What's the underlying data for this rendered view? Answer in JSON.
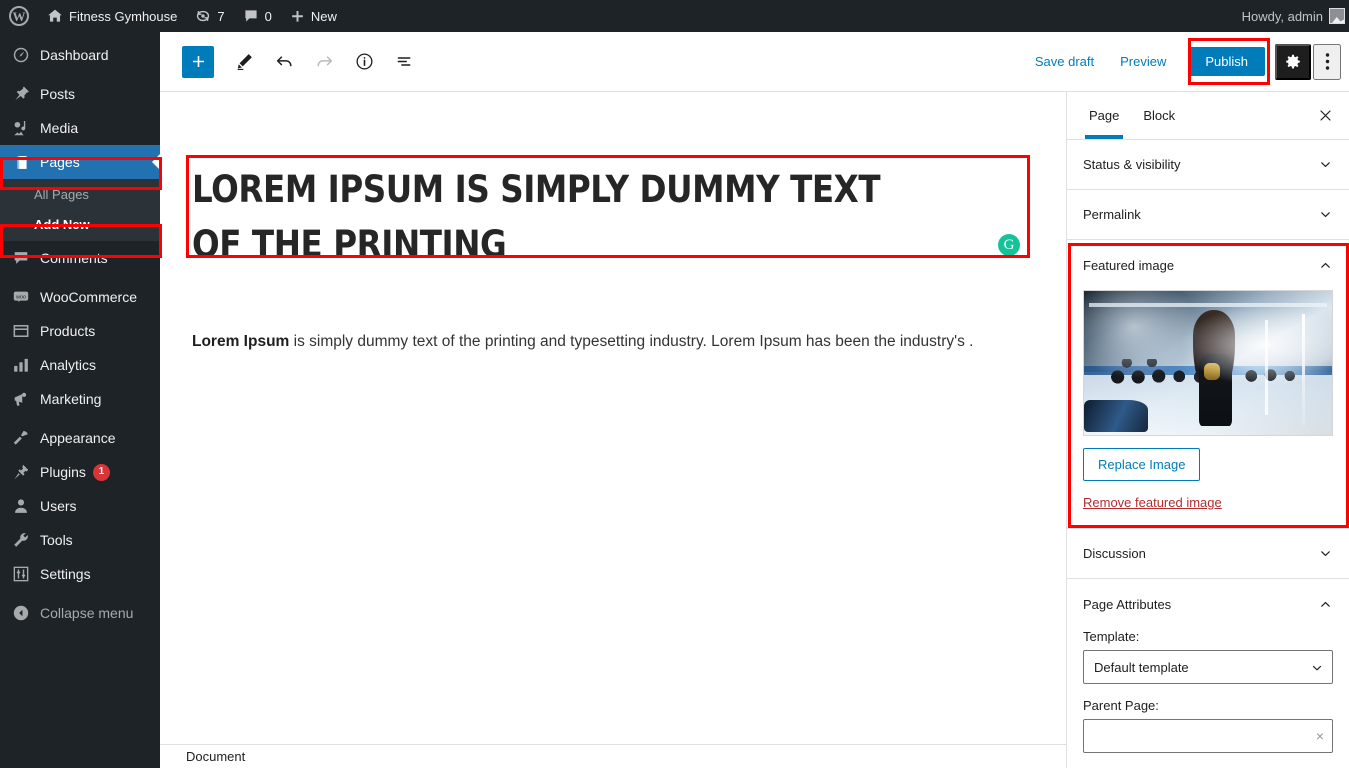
{
  "adminbar": {
    "wp_logo": "wordpress-logo",
    "site_name": "Fitness Gymhouse",
    "updates_count": "7",
    "comments_count": "0",
    "new_label": "New",
    "howdy": "Howdy, admin"
  },
  "sidebar": {
    "items": [
      {
        "label": "Dashboard",
        "icon": "dashboard-icon",
        "current": false
      },
      {
        "label": "Posts",
        "icon": "pin-icon",
        "current": false
      },
      {
        "label": "Media",
        "icon": "media-icon",
        "current": false
      },
      {
        "label": "Pages",
        "icon": "pages-icon",
        "current": true
      },
      {
        "label": "Comments",
        "icon": "comments-icon",
        "current": false
      },
      {
        "label": "WooCommerce",
        "icon": "woocommerce-icon",
        "current": false
      },
      {
        "label": "Products",
        "icon": "products-icon",
        "current": false
      },
      {
        "label": "Analytics",
        "icon": "analytics-icon",
        "current": false
      },
      {
        "label": "Marketing",
        "icon": "marketing-icon",
        "current": false
      },
      {
        "label": "Appearance",
        "icon": "appearance-icon",
        "current": false
      },
      {
        "label": "Plugins",
        "icon": "plugins-icon",
        "current": false,
        "badge": "1"
      },
      {
        "label": "Users",
        "icon": "users-icon",
        "current": false
      },
      {
        "label": "Tools",
        "icon": "tools-icon",
        "current": false
      },
      {
        "label": "Settings",
        "icon": "settings-icon",
        "current": false
      }
    ],
    "submenu": [
      {
        "label": "All Pages",
        "current": false
      },
      {
        "label": "Add New",
        "current": true
      }
    ],
    "collapse_label": "Collapse menu"
  },
  "toolbar": {
    "add_block": "+",
    "tools_icon": "pencil-icon",
    "undo_icon": "undo-icon",
    "redo_icon": "redo-icon",
    "info_icon": "info-icon",
    "outline_icon": "list-view-icon",
    "save_draft_label": "Save draft",
    "preview_label": "Preview",
    "publish_label": "Publish",
    "settings_icon": "gear-icon",
    "more_icon": "kebab-menu-icon"
  },
  "editor": {
    "title": "Lorem Ipsum is simply dummy text of the printing",
    "body_bold": "Lorem Ipsum",
    "body_rest": " is simply dummy text of the printing and typesetting industry. Lorem Ipsum has been the industry's .",
    "grammarly_badge": "G",
    "footer_breadcrumb": "Document"
  },
  "settings_panel": {
    "tabs": [
      {
        "label": "Page",
        "active": true
      },
      {
        "label": "Block",
        "active": false
      }
    ],
    "close_icon": "close-icon",
    "rows": [
      {
        "label": "Status & visibility",
        "state": "collapsed"
      },
      {
        "label": "Permalink",
        "state": "collapsed"
      }
    ],
    "featured_image": {
      "title": "Featured image",
      "state": "expanded",
      "image_alt": "gym-photo-woman-lifting-dumbbell",
      "replace_label": "Replace Image",
      "remove_label": "Remove featured image"
    },
    "discussion": {
      "label": "Discussion",
      "state": "collapsed"
    },
    "page_attributes": {
      "title": "Page Attributes",
      "state": "expanded",
      "template_label": "Template:",
      "template_value": "Default template",
      "parent_label": "Parent Page:",
      "parent_value": "",
      "parent_clear": "×"
    }
  },
  "colors": {
    "admin_dark": "#1d2327",
    "admin_submenu": "#2c3338",
    "accent_blue": "#007cba",
    "menu_current_blue": "#2271b1",
    "badge_red": "#d63638",
    "highlight_red": "#fe0000",
    "remove_red": "#b32d2e",
    "grammarly_green": "#15c39a"
  }
}
